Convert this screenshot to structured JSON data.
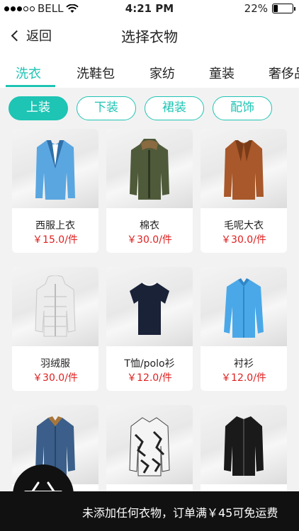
{
  "status": {
    "carrier": "BELL",
    "time": "4:21 PM",
    "battery": "22%",
    "battery_level": 0.22
  },
  "nav": {
    "back_label": "返回",
    "title": "选择衣物"
  },
  "category_tabs": [
    {
      "label": "洗衣",
      "active": true
    },
    {
      "label": "洗鞋包",
      "active": false
    },
    {
      "label": "家纺",
      "active": false
    },
    {
      "label": "童装",
      "active": false
    },
    {
      "label": "奢侈品",
      "active": false
    }
  ],
  "sub_tabs": [
    {
      "label": "上装",
      "active": true
    },
    {
      "label": "下装",
      "active": false
    },
    {
      "label": "裙装",
      "active": false
    },
    {
      "label": "配饰",
      "active": false
    }
  ],
  "products": [
    {
      "name": "西服上衣",
      "price": "￥15.0/件",
      "icon": "blazer-icon",
      "color": "#5aa6e0"
    },
    {
      "name": "棉衣",
      "price": "￥30.0/件",
      "icon": "padded-jacket-icon",
      "color": "#4f5a3a"
    },
    {
      "name": "毛呢大衣",
      "price": "￥30.0/件",
      "icon": "wool-coat-icon",
      "color": "#a8582a"
    },
    {
      "name": "羽绒服",
      "price": "￥30.0/件",
      "icon": "down-jacket-icon",
      "color": "#e8e8e8"
    },
    {
      "name": "T恤/polo衫",
      "price": "￥12.0/件",
      "icon": "tshirt-icon",
      "color": "#1a2238"
    },
    {
      "name": "衬衫",
      "price": "￥12.0/件",
      "icon": "shirt-icon",
      "color": "#4aa8e8"
    },
    {
      "name": "",
      "price": "",
      "icon": "denim-shirt-icon",
      "color": "#3b5f8a"
    },
    {
      "name": "",
      "price": "",
      "icon": "patterned-shirt-icon",
      "color": "#cccccc"
    },
    {
      "name": "",
      "price": "",
      "icon": "black-jacket-icon",
      "color": "#1a1a1a"
    }
  ],
  "bottom": {
    "message": "未添加任何衣物，订单满￥45可免运费"
  },
  "colors": {
    "accent": "#1ec4b4",
    "price": "#e02020"
  }
}
